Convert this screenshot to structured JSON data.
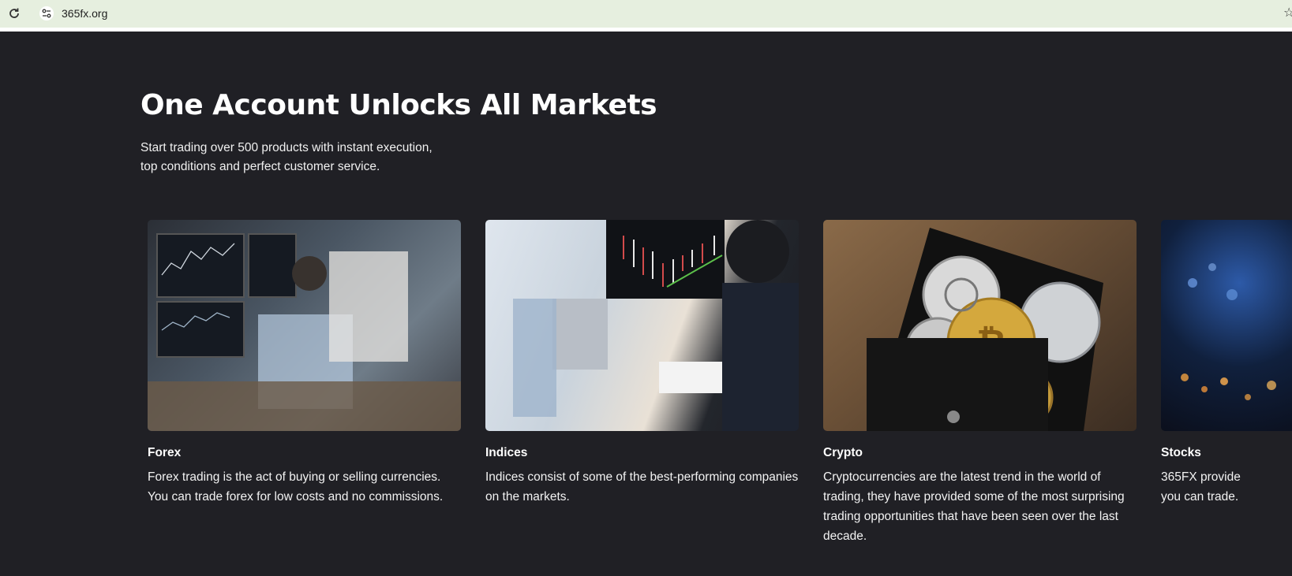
{
  "browser": {
    "url": "365fx.org"
  },
  "hero": {
    "title": "One Account Unlocks All Markets",
    "subtitle_line1": "Start trading over 500 products with instant execution,",
    "subtitle_line2": "top conditions and perfect customer service."
  },
  "markets": [
    {
      "name": "Forex",
      "description": "Forex trading is the act of buying or selling currencies. You can trade forex for low costs and no commissions."
    },
    {
      "name": "Indices",
      "description": "Indices consist of some of the best-performing companies on the markets."
    },
    {
      "name": "Crypto",
      "description": "Cryptocurrencies are the latest trend in the world of trading, they have provided some of the most surprising trading opportunities that have been seen over the last decade."
    },
    {
      "name": "Stocks",
      "description_line1": "365FX provide",
      "description_line2": "you can trade."
    }
  ]
}
